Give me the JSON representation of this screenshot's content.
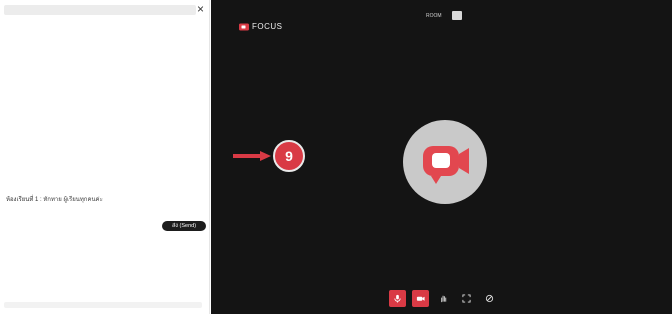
{
  "chat_panel": {
    "close_label": "×",
    "message": {
      "sender": "ห้องเรียนที่ 1",
      "text": ": ทักทาย ผู้เรียนทุกคนค่ะ"
    },
    "send_label": "ส่ง (Send)"
  },
  "toolbar": {
    "items": [
      {
        "name": "check-icon"
      },
      {
        "name": "grid-icon"
      },
      {
        "name": "download-icon"
      },
      {
        "name": "chat-icon",
        "highlighted": true
      },
      {
        "name": "apps-icon"
      },
      {
        "name": "board-icon"
      },
      {
        "name": "exit-icon"
      }
    ]
  },
  "annotation": {
    "step_number": "9",
    "accent_color": "#d93a45"
  },
  "stage": {
    "brand": "FOCUS",
    "room_label": "ROOM",
    "controls": [
      {
        "name": "mic-icon",
        "active": true
      },
      {
        "name": "camera-icon",
        "active": true
      },
      {
        "name": "hand-icon",
        "active": false
      },
      {
        "name": "fullscreen-icon",
        "active": false
      },
      {
        "name": "settings-icon",
        "active": false
      }
    ]
  },
  "colors": {
    "stage_bg": "#141414",
    "accent": "#d93a45",
    "logo_circle": "#c9c9c9"
  }
}
